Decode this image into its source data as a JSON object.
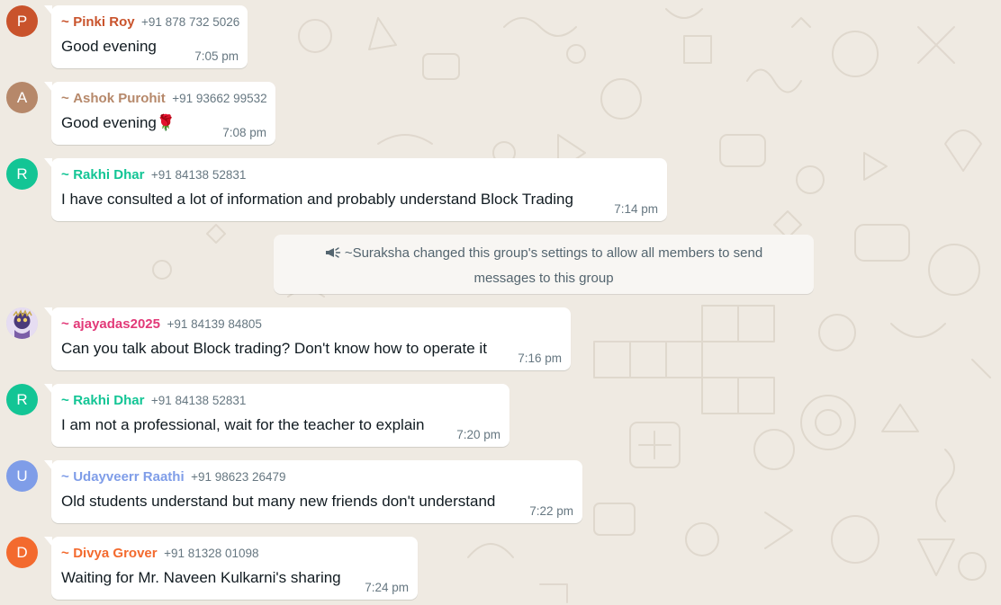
{
  "messages": [
    {
      "avatar_letter": "P",
      "avatar_color": "#c9532c",
      "name_color": "#c9532c",
      "tilde": "~",
      "sender": "Pinki Roy",
      "phone": "+91 878 732 5026",
      "text": "Good evening",
      "time": "7:05 pm"
    },
    {
      "avatar_letter": "A",
      "avatar_color": "#b6886a",
      "name_color": "#b6886a",
      "tilde": "~",
      "sender": "Ashok Purohit",
      "phone": "+91 93662 99532",
      "text": "Good evening",
      "emoji": "🌹",
      "time": "7:08 pm"
    },
    {
      "avatar_letter": "R",
      "avatar_color": "#13c595",
      "name_color": "#13c595",
      "tilde": "~",
      "sender": "Rakhi Dhar",
      "phone": "+91 84138 52831",
      "text": "I have consulted a lot of information and probably understand Block Trading",
      "time": "7:14 pm"
    },
    {
      "avatar_icon": "profile-photo",
      "name_color": "#e23978",
      "tilde": "~",
      "sender": "ajayadas2025",
      "phone": "+91 84139 84805",
      "text": "Can you talk about Block trading? Don't know how to operate it",
      "time": "7:16 pm"
    },
    {
      "avatar_letter": "R",
      "avatar_color": "#13c595",
      "name_color": "#13c595",
      "tilde": "~",
      "sender": "Rakhi Dhar",
      "phone": "+91 84138 52831",
      "text": "I am not a professional, wait for the teacher to explain",
      "time": "7:20 pm"
    },
    {
      "avatar_letter": "U",
      "avatar_color": "#7f9de8",
      "name_color": "#7f9de8",
      "tilde": "~",
      "sender": "Udayveerr Raathi",
      "phone": "+91 98623 26479",
      "text": "Old students understand but many new friends don't understand",
      "time": "7:22 pm"
    },
    {
      "avatar_letter": "D",
      "avatar_color": "#f36a2e",
      "name_color": "#f36a2e",
      "tilde": "~",
      "sender": "Divya Grover",
      "phone": "+91 81328 01098",
      "text": "Waiting for Mr. Naveen Kulkarni's sharing",
      "time": "7:24 pm"
    }
  ],
  "system_message": {
    "icon": "megaphone-icon",
    "text": "~Suraksha changed this group's settings to allow all members to send messages to this group"
  },
  "colors": {
    "chat_background": "#efeae2",
    "bubble": "#ffffff",
    "system_bubble": "#f8f6f3",
    "text": "#111b21",
    "meta": "#667781"
  }
}
